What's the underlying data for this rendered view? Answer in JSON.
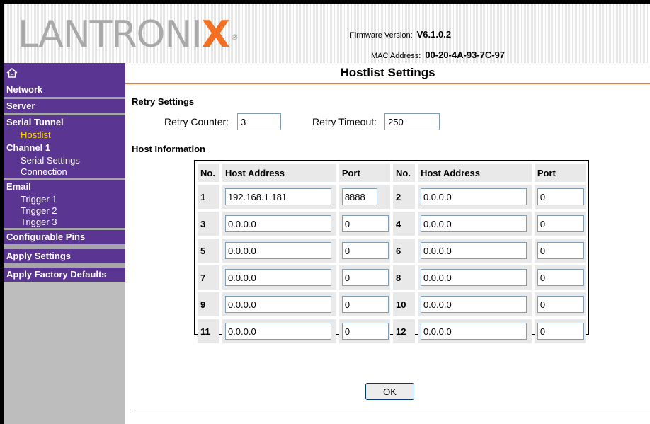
{
  "brand": {
    "logo_text": "LANTRONI",
    "logo_x": "X",
    "logo_reg": "®"
  },
  "firmware": {
    "label": "Firmware Version:",
    "value": "V6.1.0.2"
  },
  "mac": {
    "label": "MAC Address:",
    "value": "00-20-4A-93-7C-97"
  },
  "sidebar": {
    "network": "Network",
    "server": "Server",
    "serial_tunnel": "Serial Tunnel",
    "hostlist": "Hostlist",
    "channel1": "Channel 1",
    "serial_settings": "Serial Settings",
    "connection": "Connection",
    "email": "Email",
    "trigger1": "Trigger 1",
    "trigger2": "Trigger 2",
    "trigger3": "Trigger 3",
    "configurable_pins": "Configurable Pins",
    "apply_settings": "Apply Settings",
    "apply_factory_defaults": "Apply Factory Defaults"
  },
  "page_title": "Hostlist Settings",
  "retry": {
    "section_label": "Retry Settings",
    "counter_label": "Retry Counter:",
    "counter_value": "3",
    "timeout_label": "Retry Timeout:",
    "timeout_value": "250"
  },
  "host_info": {
    "section_label": "Host Information",
    "headers": {
      "no": "No.",
      "host_address": "Host Address",
      "port": "Port"
    },
    "rows": [
      {
        "no1": "1",
        "addr1": "192.168.1.181",
        "port1": "8888",
        "no2": "2",
        "addr2": "0.0.0.0",
        "port2": "0"
      },
      {
        "no1": "3",
        "addr1": "0.0.0.0",
        "port1": "0",
        "no2": "4",
        "addr2": "0.0.0.0",
        "port2": "0"
      },
      {
        "no1": "5",
        "addr1": "0.0.0.0",
        "port1": "0",
        "no2": "6",
        "addr2": "0.0.0.0",
        "port2": "0"
      },
      {
        "no1": "7",
        "addr1": "0.0.0.0",
        "port1": "0",
        "no2": "8",
        "addr2": "0.0.0.0",
        "port2": "0"
      },
      {
        "no1": "9",
        "addr1": "0.0.0.0",
        "port1": "0",
        "no2": "10",
        "addr2": "0.0.0.0",
        "port2": "0"
      },
      {
        "no1": "11",
        "addr1": "0.0.0.0",
        "port1": "0",
        "no2": "12",
        "addr2": "0.0.0.0",
        "port2": "0"
      }
    ]
  },
  "ok_label": "OK",
  "colors": {
    "accent": "#f36f21",
    "nav_bg": "#5a3591",
    "active_nav": "#ffd700"
  }
}
